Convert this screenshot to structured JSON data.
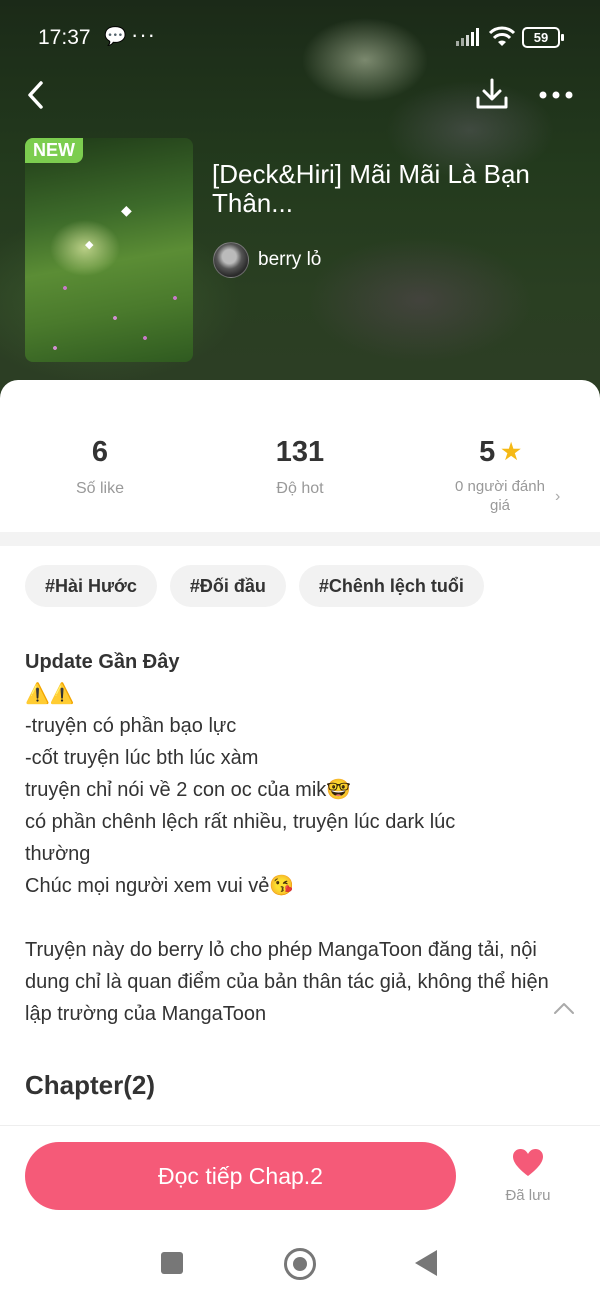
{
  "status_bar": {
    "time": "17:37",
    "battery": "59"
  },
  "book": {
    "badge": "NEW",
    "title": "[Deck&Hiri] Mãi Mãi Là Bạn Thân...",
    "author": "berry lỏ"
  },
  "stats": {
    "likes": {
      "value": "6",
      "label": "Số like"
    },
    "hot": {
      "value": "131",
      "label": "Độ hot"
    },
    "rating": {
      "value": "5",
      "label": "0 người đánh giá"
    }
  },
  "tags": [
    "#Hài Hước",
    "#Đối đầu",
    "#Chênh lệch tuổi"
  ],
  "description": {
    "heading": "Update Gần Đây",
    "warning_line": "⚠️⚠️",
    "lines": [
      "-truyện có phần bạo lực",
      "-cốt truyện lúc bth lúc xàm",
      "truyện chỉ nói về 2 con oc của mik🤓",
      "có phần chênh lệch rất nhiều, truyện lúc dark lúc thường",
      "Chúc mọi người xem vui vẻ😘"
    ],
    "notice": "Truyện này do berry lỏ cho phép MangaToon đăng tải, nội dung chỉ là quan điểm của bản thân tác giả, không thể hiện lập trường của MangaToon"
  },
  "chapters": {
    "heading": "Chapter(2)"
  },
  "actions": {
    "read_button": "Đọc tiếp Chap.2",
    "saved_label": "Đã lưu"
  },
  "colors": {
    "accent": "#f55a78",
    "badge_green": "#7ccd4f",
    "star": "#f5b916"
  }
}
